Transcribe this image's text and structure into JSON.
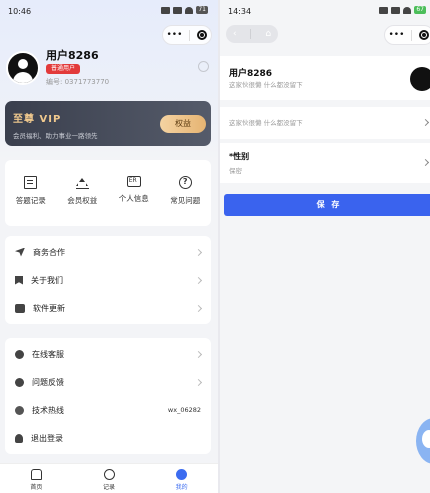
{
  "left": {
    "status": {
      "time": "10:46",
      "battery": "71"
    },
    "profile": {
      "username": "用户8286",
      "badge": "普通用户",
      "uid": "编号: 0371773770"
    },
    "vip": {
      "title": "至尊 VIP",
      "subtitle": "会员福利、助力事业一路领先",
      "button": "权益"
    },
    "grid": [
      {
        "icon": "document-icon",
        "label": "答题记录"
      },
      {
        "icon": "crown-icon",
        "label": "会员权益"
      },
      {
        "icon": "id-card-icon",
        "label": "个人信息"
      },
      {
        "icon": "help-icon",
        "label": "常见问题"
      }
    ],
    "menu1": [
      {
        "icon": "send-icon",
        "label": "商务合作"
      },
      {
        "icon": "bookmark-icon",
        "label": "关于我们"
      },
      {
        "icon": "chat-icon",
        "label": "软件更新"
      }
    ],
    "menu2": [
      {
        "icon": "agent-icon",
        "label": "在线客服"
      },
      {
        "icon": "info-icon",
        "label": "问题反馈"
      },
      {
        "icon": "tech-icon",
        "label": "技术热线",
        "value": "wx_06282"
      },
      {
        "icon": "user-icon",
        "label": "退出登录"
      }
    ],
    "tabs": [
      {
        "icon": "home-icon",
        "label": "首页"
      },
      {
        "icon": "circle-icon",
        "label": "记录"
      },
      {
        "icon": "me-icon",
        "label": "我的",
        "active": true
      }
    ]
  },
  "right": {
    "status": {
      "time": "14:34",
      "battery": "67"
    },
    "profile": {
      "username": "用户8286",
      "signature": "这家伙很懒 什么都没留下"
    },
    "signature_field": "这家伙很懒 什么都没留下",
    "gender": {
      "label": "*性别",
      "value": "保密"
    },
    "save_label": "保 存"
  },
  "colors": {
    "primary": "#3a63ee",
    "vip_gold": "#f0c98e",
    "badge_red": "#e23a3a"
  }
}
